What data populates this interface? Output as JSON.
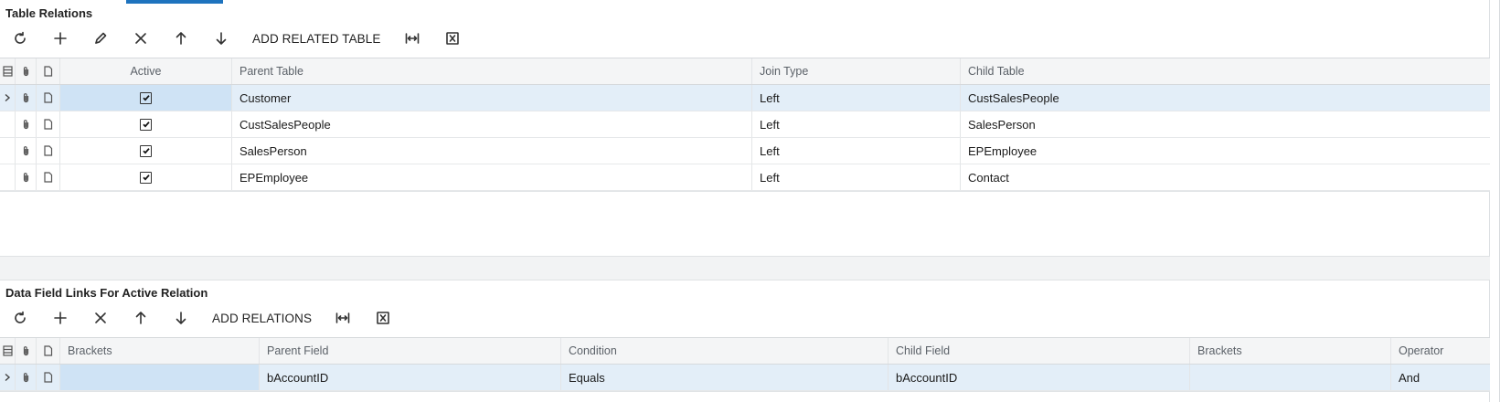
{
  "relations": {
    "title": "Table Relations",
    "toolbar": {
      "add_related_label": "ADD RELATED TABLE",
      "icons": [
        "refresh-icon",
        "plus-icon",
        "pencil-icon",
        "close-icon",
        "arrow-up-icon",
        "arrow-down-icon",
        "fit-columns-icon",
        "excel-icon"
      ]
    },
    "columns": {
      "active": "Active",
      "parent_table": "Parent Table",
      "join_type": "Join Type",
      "child_table": "Child Table"
    },
    "rows": [
      {
        "active": true,
        "parent_table": "Customer",
        "join_type": "Left",
        "child_table": "CustSalesPeople"
      },
      {
        "active": true,
        "parent_table": "CustSalesPeople",
        "join_type": "Left",
        "child_table": "SalesPerson"
      },
      {
        "active": true,
        "parent_table": "SalesPerson",
        "join_type": "Left",
        "child_table": "EPEmployee"
      },
      {
        "active": true,
        "parent_table": "EPEmployee",
        "join_type": "Left",
        "child_table": "Contact"
      }
    ]
  },
  "links": {
    "title": "Data Field Links For Active Relation",
    "toolbar": {
      "add_relations_label": "ADD RELATIONS"
    },
    "columns": {
      "brackets_open": "Brackets",
      "parent_field": "Parent Field",
      "condition": "Condition",
      "child_field": "Child Field",
      "brackets_close": "Brackets",
      "operator": "Operator"
    },
    "rows": [
      {
        "brackets_open": "",
        "parent_field": "bAccountID",
        "condition": "Equals",
        "child_field": "bAccountID",
        "brackets_close": "",
        "operator": "And"
      }
    ]
  },
  "colors": {
    "accent": "#1e73be",
    "selected_row": "#e3eef8",
    "selected_cell": "#cfe3f5"
  }
}
